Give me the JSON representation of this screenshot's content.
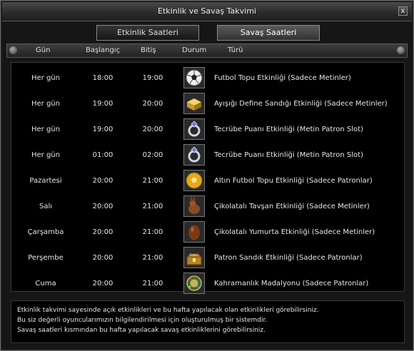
{
  "window": {
    "title": "Etkinlik ve Savaş Takvimi",
    "close_glyph": "x"
  },
  "tabs": [
    {
      "label": "Etkinlik Saatleri",
      "active": false
    },
    {
      "label": "Savaş Saatleri",
      "active": true
    }
  ],
  "columns": {
    "day": "Gün",
    "start": "Başlangıç",
    "end": "Bitiş",
    "status": "Durum",
    "type": "Türü"
  },
  "events": [
    {
      "day": "Her gün",
      "start": "18:00",
      "end": "19:00",
      "icon": "football-icon",
      "type": "Futbol Topu Etkinliği (Sadece Metinler)"
    },
    {
      "day": "Her gün",
      "start": "19:00",
      "end": "20:00",
      "icon": "gold-chest-icon",
      "type": "Ayışığı Define Sandığı Etkinliği (Sadece Metinler)"
    },
    {
      "day": "Her gün",
      "start": "19:00",
      "end": "20:00",
      "icon": "ring-icon",
      "type": "Tecrübe Puanı Etkinliği (Metin Patron Slot)"
    },
    {
      "day": "Her gün",
      "start": "01:00",
      "end": "02:00",
      "icon": "ring-icon",
      "type": "Tecrübe Puanı Etkinliği (Metin Patron Slot)"
    },
    {
      "day": "Pazartesi",
      "start": "20:00",
      "end": "21:00",
      "icon": "golden-ball-icon",
      "type": "Altın Futbol Topu Etkinliği (Sadece Patronlar)"
    },
    {
      "day": "Salı",
      "start": "20:00",
      "end": "21:00",
      "icon": "chocolate-bunny-icon",
      "type": "Çikolatalı Tavşan Etkinliği (Sadece Metinler)"
    },
    {
      "day": "Çarşamba",
      "start": "20:00",
      "end": "21:00",
      "icon": "chocolate-egg-icon",
      "type": "Çikolatalı Yumurta Etkinliği (Sadece Metinler)"
    },
    {
      "day": "Perşembe",
      "start": "20:00",
      "end": "21:00",
      "icon": "treasure-chest-icon",
      "type": "Patron Sandık Etkinliği (Sadece Patronlar)"
    },
    {
      "day": "Cuma",
      "start": "20:00",
      "end": "21:00",
      "icon": "medal-icon",
      "type": "Kahramanlık Madalyonu (Sadece Patronlar)"
    }
  ],
  "footer": {
    "line1": "Etkinlik takvimi sayesinde açık etkinlikleri ve bu hafta yapılacak olan etkinlikleri görebilirsiniz.",
    "line2": "Bu siz değerli oyuncularımızın bilgilendirilmesi için oluşturulmuş bir sistemdir.",
    "line3": "Savaş saatleri kısmından bu hafta yapılacak savaş etkinliklerini görebilirsiniz."
  }
}
